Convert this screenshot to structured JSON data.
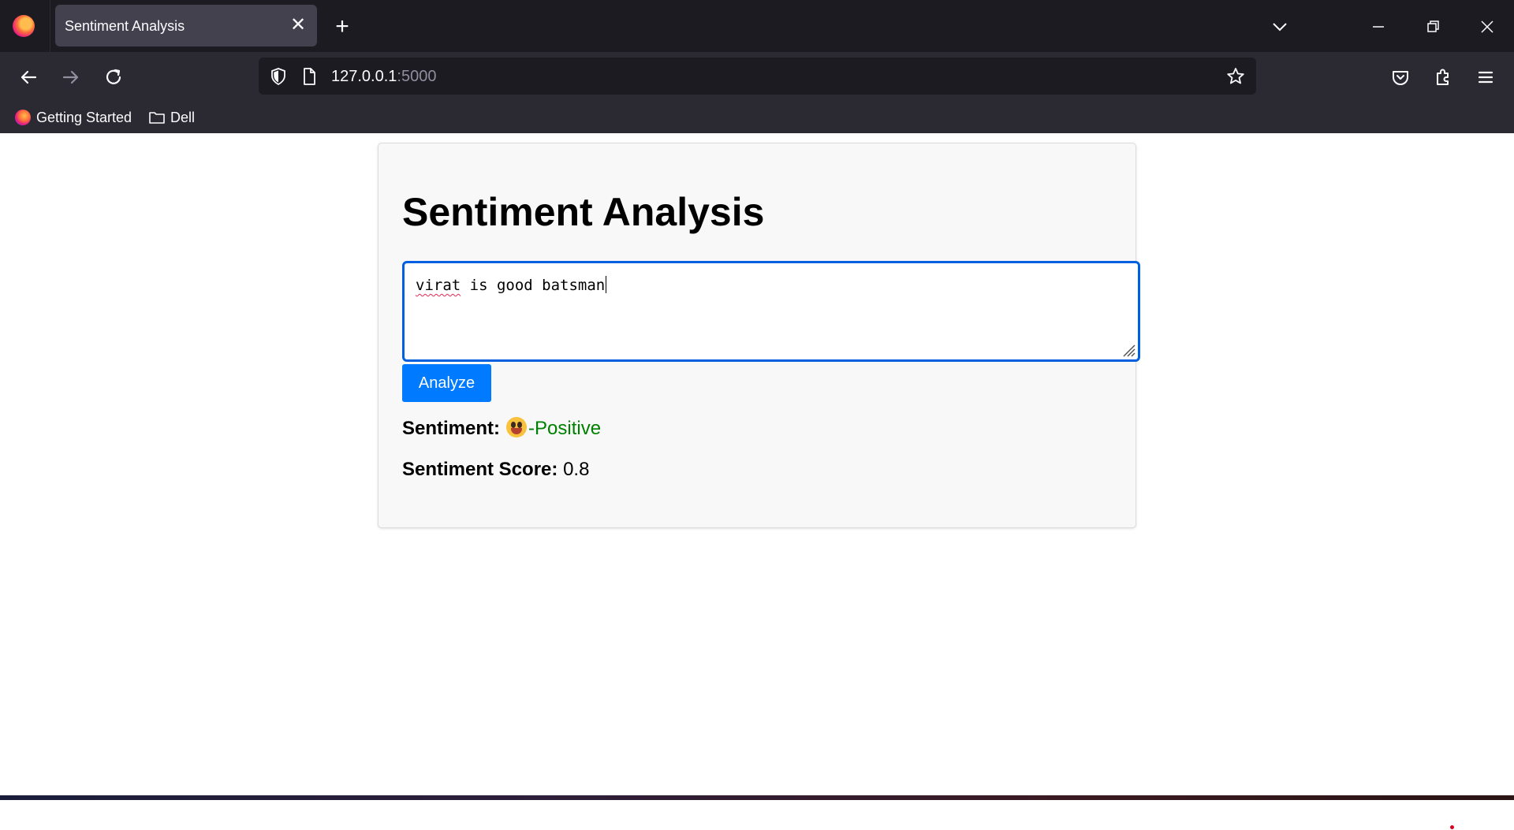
{
  "browser": {
    "tab_title": "Sentiment Analysis",
    "url_host": "127.0.0.1",
    "url_port": ":5000",
    "bookmarks": [
      {
        "label": "Getting Started",
        "icon": "firefox-icon"
      },
      {
        "label": "Dell",
        "icon": "folder-icon"
      }
    ]
  },
  "app": {
    "title": "Sentiment Analysis",
    "input_value_misspelled": "virat",
    "input_value_rest": " is good batsman",
    "analyze_label": "Analyze",
    "sentiment_label": "Sentiment:",
    "sentiment_emoji": "grinning-face-emoji",
    "sentiment_value": "-Positive",
    "score_label": "Sentiment Score:",
    "score_value": "0.8"
  },
  "colors": {
    "accent_button": "#007bff",
    "positive": "#008000",
    "focus_border": "#0060df"
  }
}
